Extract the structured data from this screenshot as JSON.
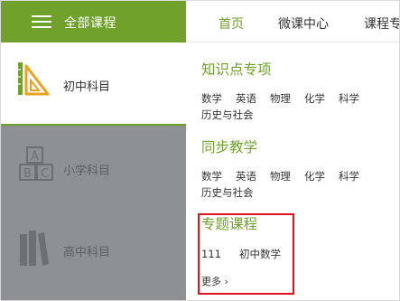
{
  "sidebar": {
    "title": "全部课程",
    "items": [
      {
        "label": "初中科目",
        "icon": "ruler-triangle-icon"
      },
      {
        "label": "小学科目",
        "icon": "abc-blocks-icon"
      },
      {
        "label": "高中科目",
        "icon": "books-icon"
      }
    ]
  },
  "nav": {
    "tabs": [
      {
        "label": "首页"
      },
      {
        "label": "微课中心"
      },
      {
        "label": "课程专"
      }
    ]
  },
  "sections": [
    {
      "title": "知识点专项",
      "links": [
        "数学",
        "英语",
        "物理",
        "化学",
        "科学",
        "历史与社会"
      ]
    },
    {
      "title": "同步教学",
      "links": [
        "数学",
        "英语",
        "物理",
        "化学",
        "科学",
        "历史与社会"
      ]
    },
    {
      "title": "专题课程",
      "links": [
        "111",
        "初中数学"
      ],
      "more": "更多 ›"
    }
  ],
  "colors": {
    "accent": "#6fa12b",
    "highlight_box": "#e0141e",
    "overlay_gray": "#8c8f92"
  }
}
